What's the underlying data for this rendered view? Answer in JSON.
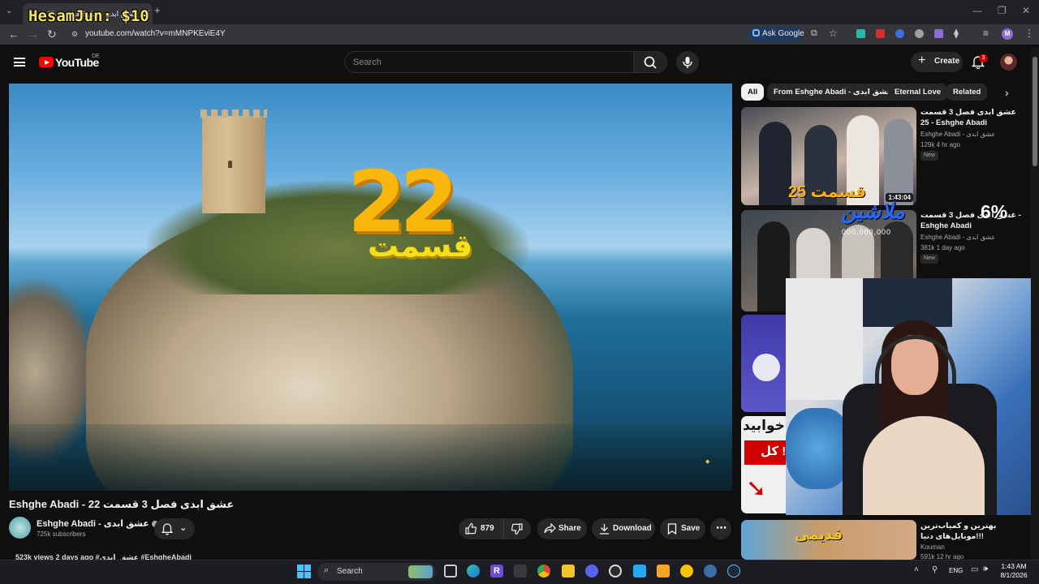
{
  "browser": {
    "tab_title": "(3) عشق ابدی فصل 3 قسمت",
    "overlay_name": "HesamJun: $10",
    "url": "youtube.com/watch?v=mMNPKEviE4Y",
    "ask_google_label": "Ask Google",
    "profile_initial": "M"
  },
  "header": {
    "logo_text": "YouTube",
    "country_code": "DE",
    "search_placeholder": "Search",
    "create_label": "Create",
    "notification_count": "3"
  },
  "player": {
    "overlay_number": "22",
    "overlay_word": "قسمت"
  },
  "video": {
    "title": "Eshghe Abadi - عشق ابدی فصل 3 قسمت 22",
    "channel_name": "Eshghe Abadi - عشق ابدی",
    "subscribers": "725k subscribers",
    "likes": "879",
    "share_label": "Share",
    "download_label": "Download",
    "save_label": "Save",
    "meta_line": "523k views  2 days ago  #عشق_ابدی #EshgheAbadi"
  },
  "chips": [
    "All",
    "From Eshghe Abadi - عشق ابدی",
    "Eternal Love",
    "Related"
  ],
  "recommendations": [
    {
      "title": "عشق ابدی فصل 3 قسمت 25 - Eshghe Abadi",
      "channel": "Eshghe Abadi - عشق ابدی",
      "meta": "129k  4 hr ago",
      "badge": "New",
      "duration": "1:43:04",
      "thumb_text": "قسمت 25"
    },
    {
      "title": "عشق ابدی فصل 3 قسمت - Eshghe Abadi",
      "channel": "Eshghe Abadi - عشق ابدی",
      "meta": "381k  1 day ago",
      "badge": "New"
    },
    {
      "title": "بهترین و کمیاب‌ترین موبایل‌های دنیا!!!",
      "channel": "Kouman",
      "meta": "591k  12 hr ago",
      "thumb_text": "قدیمی"
    }
  ],
  "stream_overlay": {
    "donation_text": "ملاشین",
    "donation_sub": "000,000,000",
    "percent": "6%",
    "side_thumb_text": "خوابید",
    "side_thumb_badge": "کل !"
  },
  "taskbar": {
    "search_label": "Search",
    "language": "ENG",
    "time": "1:43 AM",
    "date": "8/1/2026"
  }
}
